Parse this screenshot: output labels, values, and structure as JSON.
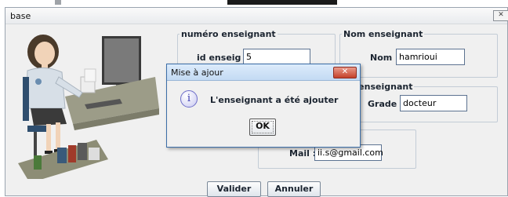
{
  "window": {
    "title": "base"
  },
  "groups": {
    "numero": {
      "legend": "numéro enseignant",
      "label": "id enseig :",
      "value": "5"
    },
    "nom": {
      "legend": "Nom enseignant",
      "label": "Nom :",
      "value": "hamrioui"
    },
    "grade": {
      "legend_partial": "de enseignant",
      "label": "Grade :",
      "value": "docteur"
    },
    "mail": {
      "label": "Mail :",
      "value": "ii.s@gmail.com"
    }
  },
  "buttons": {
    "valider": "Valider",
    "annuler": "Annuler"
  },
  "dialog": {
    "title": "Mise à ajour",
    "message": "L'enseignant a été ajouter",
    "ok": "OK",
    "icon": "info-icon"
  },
  "colors": {
    "window_bg": "#f0f0f0",
    "dialog_title": "#c3daf3",
    "close_red": "#c4412a"
  }
}
